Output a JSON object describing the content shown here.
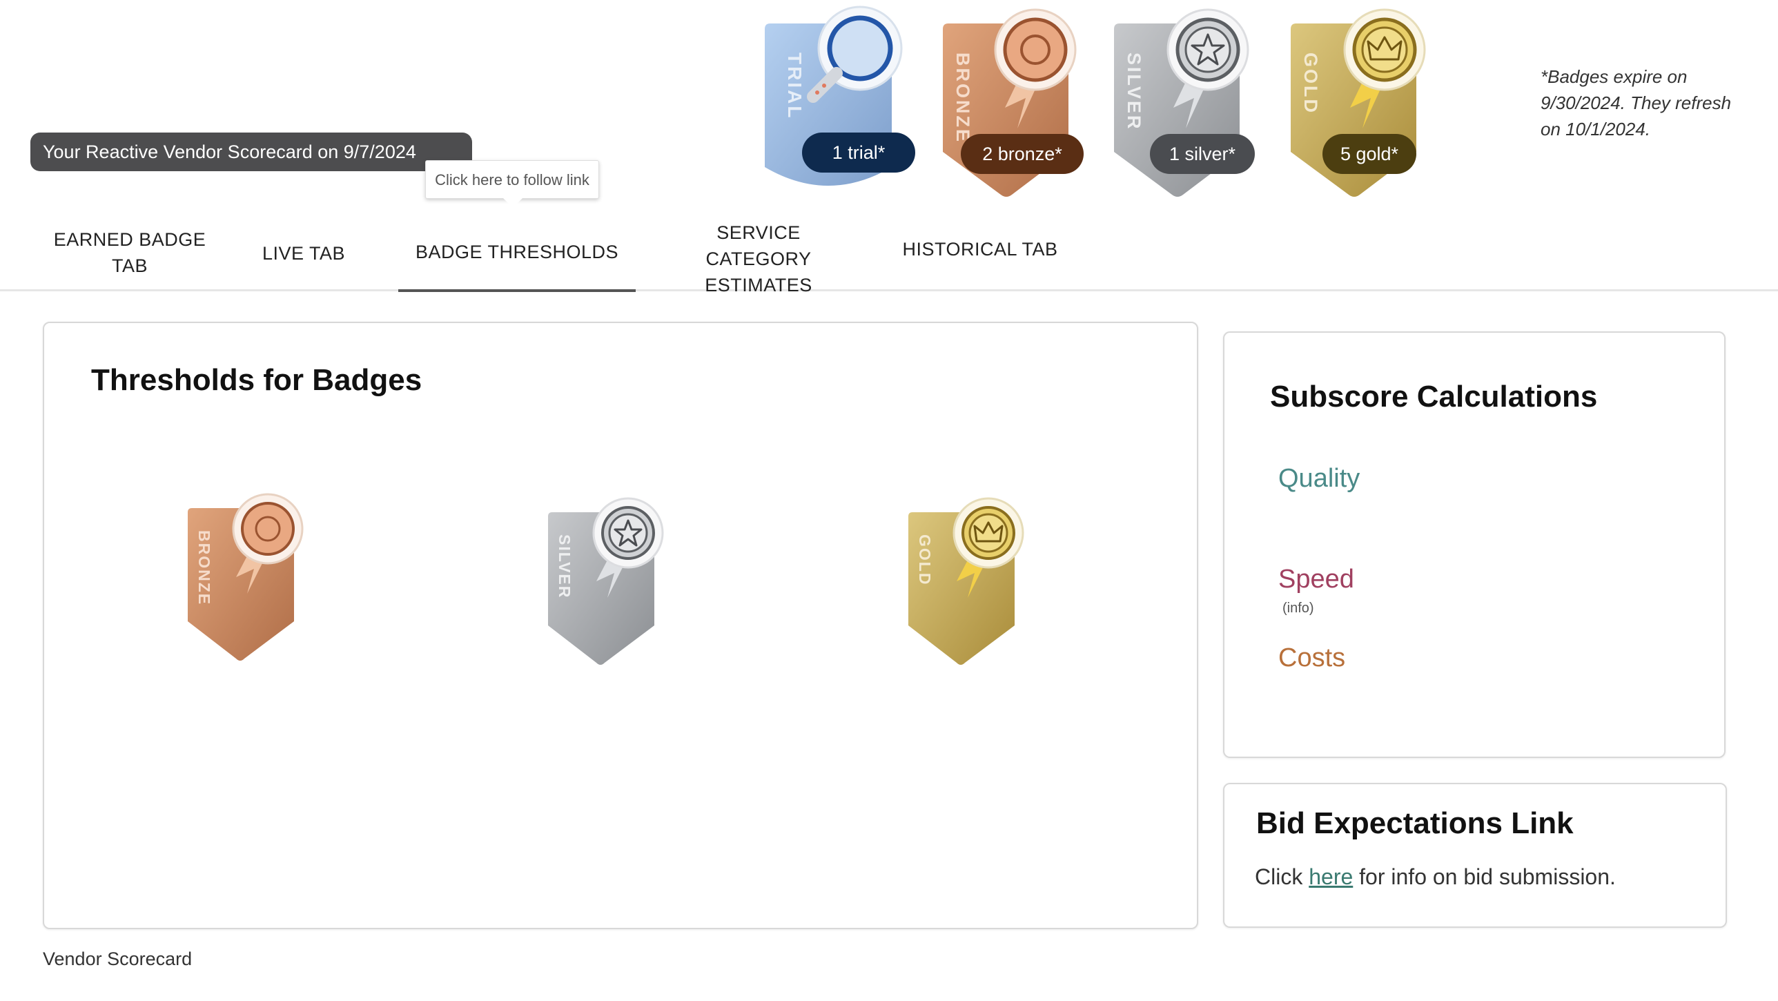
{
  "header": {
    "title": "Your Reactive Vendor Scorecard on 9/7/2024",
    "tooltip": "Click here to follow link"
  },
  "earned_badges": [
    {
      "kind": "trial",
      "ribbon_text": "TRIAL",
      "count_label": "1 trial*",
      "color": "#8fb2dc"
    },
    {
      "kind": "bronze",
      "ribbon_text": "BRONZE",
      "count_label": "2 bronze*",
      "color": "#c98a62"
    },
    {
      "kind": "silver",
      "ribbon_text": "SILVER",
      "count_label": "1 silver*",
      "color": "#a8aaad"
    },
    {
      "kind": "gold",
      "ribbon_text": "GOLD",
      "count_label": "5 gold*",
      "color": "#c8ae5a"
    }
  ],
  "expire_note": "*Badges expire on 9/30/2024. They refresh on 10/1/2024.",
  "tabs": [
    {
      "label_line1": "EARNED BADGE",
      "label_line2": "TAB",
      "active": false
    },
    {
      "label_line1": "LIVE TAB",
      "label_line2": "",
      "active": false
    },
    {
      "label_line1": "BADGE THRESHOLDS",
      "label_line2": "",
      "active": true
    },
    {
      "label_line1": "SERVICE CATEGORY",
      "label_line2": "ESTIMATES",
      "active": false
    },
    {
      "label_line1": "HISTORICAL TAB",
      "label_line2": "",
      "active": false
    }
  ],
  "thresholds": {
    "title": "Thresholds for Badges",
    "badges": [
      {
        "ribbon_text": "BRONZE"
      },
      {
        "ribbon_text": "SILVER"
      },
      {
        "ribbon_text": "GOLD"
      }
    ]
  },
  "subscore": {
    "title": "Subscore Calculations",
    "quality": {
      "label": "Quality",
      "color": "#4a8a88"
    },
    "speed": {
      "label": "Speed",
      "info": "(info)",
      "color": "#a04060"
    },
    "costs": {
      "label": "Costs",
      "color": "#b8703a"
    }
  },
  "bid": {
    "title": "Bid Expectations Link",
    "prefix": "Click ",
    "link_text": "here",
    "suffix": " for info on bid submission."
  },
  "footer": "Vendor Scorecard"
}
